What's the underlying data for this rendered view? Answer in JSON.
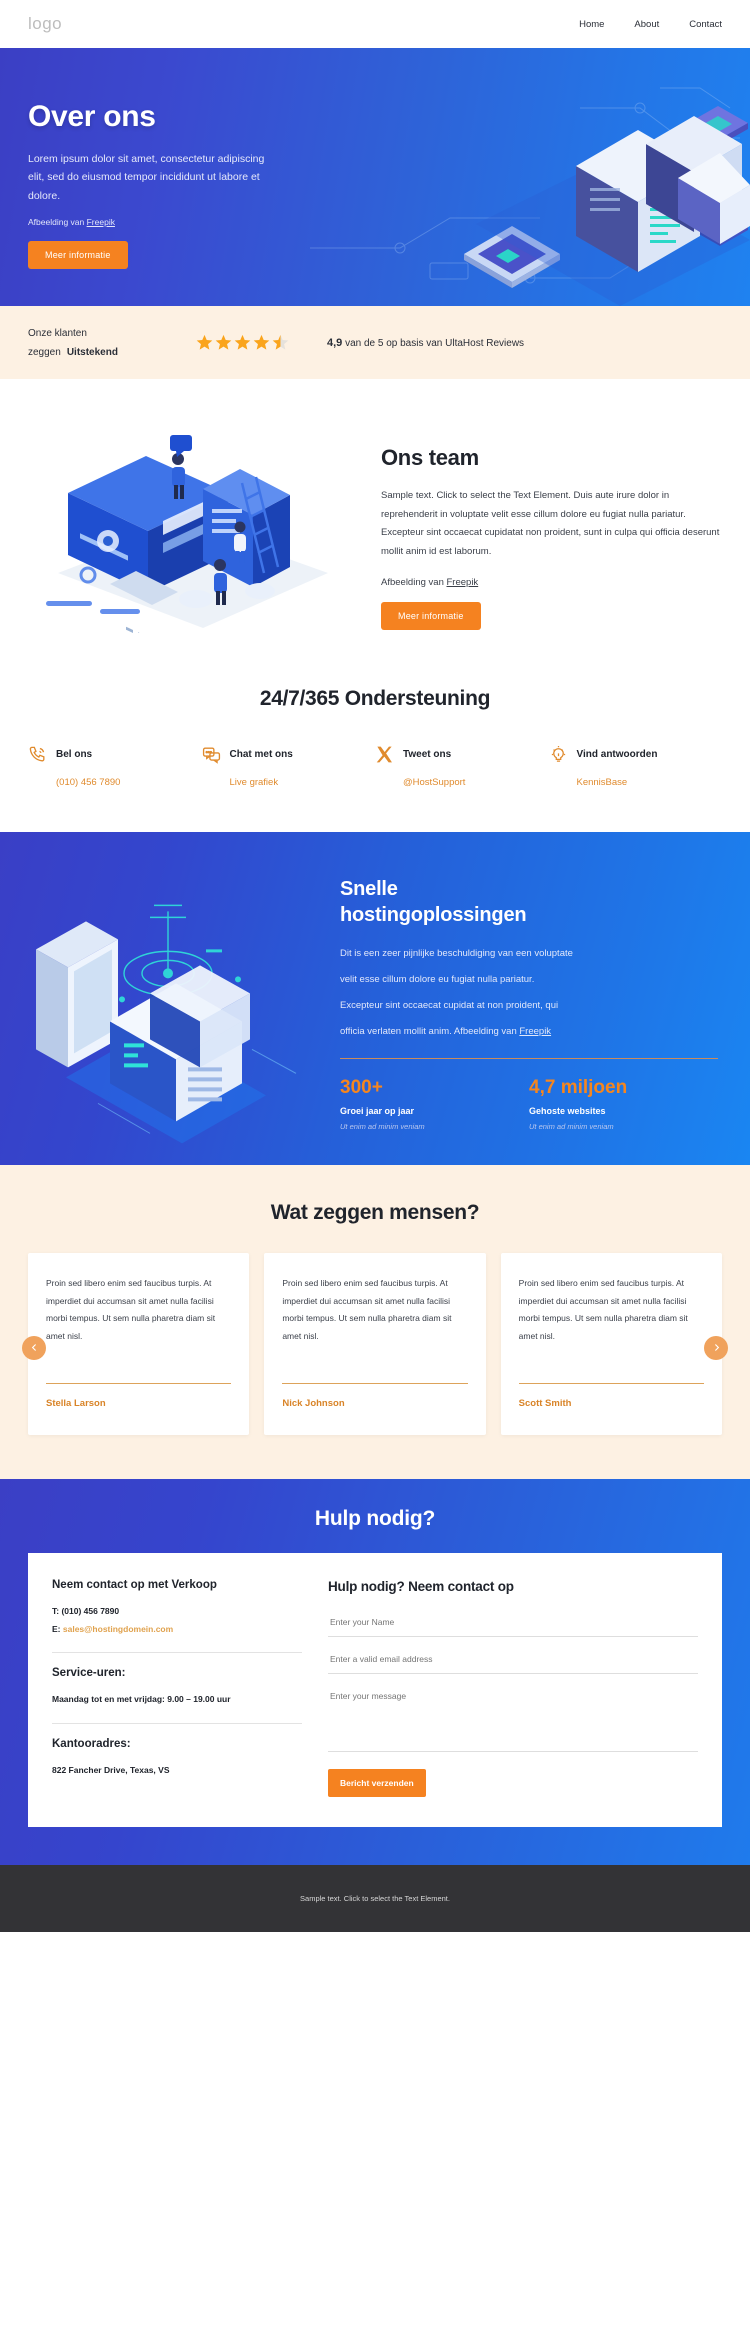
{
  "header": {
    "logo": "logo",
    "nav": [
      {
        "label": "Home"
      },
      {
        "label": "About"
      },
      {
        "label": "Contact"
      }
    ]
  },
  "hero": {
    "title": "Over ons",
    "paragraph": "Lorem ipsum dolor sit amet, consectetur adipiscing elit, sed do eiusmod tempor incididunt ut labore et dolore.",
    "credit_prefix": "Afbeelding van ",
    "credit_link": "Freepik",
    "cta": "Meer informatie"
  },
  "rating": {
    "line1": "Onze klanten",
    "line2_prefix": "zeggen",
    "line2_strong": "Uitstekend",
    "stars_filled": 4,
    "stars_half": 1,
    "score": "4,9",
    "score_text": "van de 5 op basis van UltaHost Reviews"
  },
  "team": {
    "title": "Ons team",
    "paragraph": "Sample text. Click to select the Text Element. Duis aute irure dolor in reprehenderit in voluptate velit esse cillum dolore eu fugiat nulla pariatur. Excepteur sint occaecat cupidatat non proident, sunt in culpa qui officia deserunt mollit anim id est laborum.",
    "credit_prefix": "Afbeelding van ",
    "credit_link": "Freepik",
    "cta": "Meer informatie"
  },
  "support": {
    "title": "24/7/365 Ondersteuning",
    "items": [
      {
        "icon": "phone-icon",
        "label": "Bel ons",
        "link": "(010) 456 7890"
      },
      {
        "icon": "chat-icon",
        "label": "Chat met ons",
        "link": "Live grafiek"
      },
      {
        "icon": "x-twitter-icon",
        "label": "Tweet ons",
        "link": "@HostSupport"
      },
      {
        "icon": "lightbulb-icon",
        "label": "Vind antwoorden",
        "link": "KennisBase"
      }
    ]
  },
  "hosting": {
    "title_line1": "Snelle",
    "title_line2": "hostingoplossingen",
    "p1": "Dit is een zeer pijnlijke beschuldiging van een voluptate",
    "p2": "velit esse cillum dolore eu fugiat nulla pariatur.",
    "p3": "Excepteur sint occaecat cupidat at non proident, qui",
    "p4_prefix": "officia verlaten mollit anim.  Afbeelding van ",
    "p4_link": "Freepik",
    "stats": [
      {
        "number": "300+",
        "label": "Groei jaar op jaar",
        "sub": "Ut enim ad minim veniam"
      },
      {
        "number": "4,7 miljoen",
        "label": "Gehoste websites",
        "sub": "Ut enim ad minim veniam"
      }
    ]
  },
  "testimonials": {
    "title": "Wat zeggen mensen?",
    "prev_icon": "chevron-left-icon",
    "next_icon": "chevron-right-icon",
    "cards": [
      {
        "quote": "Proin sed libero enim sed faucibus turpis. At imperdiet dui accumsan sit amet nulla facilisi morbi tempus. Ut sem nulla pharetra diam sit amet nisl.",
        "name": "Stella Larson"
      },
      {
        "quote": "Proin sed libero enim sed faucibus turpis. At imperdiet dui accumsan sit amet nulla facilisi morbi tempus. Ut sem nulla pharetra diam sit amet nisl.",
        "name": "Nick Johnson"
      },
      {
        "quote": "Proin sed libero enim sed faucibus turpis. At imperdiet dui accumsan sit amet nulla facilisi morbi tempus. Ut sem nulla pharetra diam sit amet nisl.",
        "name": "Scott Smith"
      }
    ]
  },
  "contact": {
    "title": "Hulp nodig?",
    "left": {
      "heading": "Neem contact op met Verkoop",
      "phone_prefix": "T: ",
      "phone": "(010) 456 7890",
      "email_prefix": "E: ",
      "email": "sales@hostingdomein.com",
      "hours_heading": "Service-uren:",
      "hours": "Maandag tot en met vrijdag: 9.00 – 19.00 uur",
      "address_heading": "Kantooradres:",
      "address": "822 Fancher Drive, Texas, VS"
    },
    "form": {
      "heading": "Hulp nodig? Neem contact op",
      "name_placeholder": "Enter your Name",
      "email_placeholder": "Enter a valid email address",
      "message_placeholder": "Enter your message",
      "submit": "Bericht verzenden"
    }
  },
  "footer": {
    "text": "Sample text. Click to select the Text Element."
  },
  "colors": {
    "orange": "#f58220",
    "orange_link": "#e08b2e",
    "cream": "#fdf1e3",
    "blue_start": "#3b3fc4",
    "blue_end": "#1f82f0",
    "footer": "#333336"
  }
}
